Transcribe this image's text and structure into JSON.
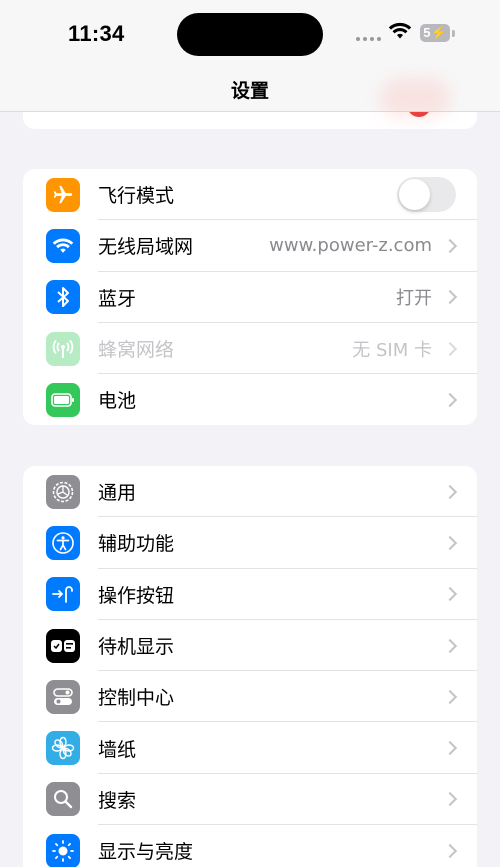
{
  "status_bar": {
    "time": "11:34",
    "battery_level": "5"
  },
  "nav": {
    "title": "设置"
  },
  "colors": {
    "airplane": "#ff9500",
    "wifi": "#007aff",
    "bluetooth": "#007aff",
    "cellular": "#34c759",
    "battery": "#34c759",
    "general": "#8e8e93",
    "accessibility": "#007aff",
    "action_button": "#007aff",
    "standby": "#000000",
    "control_center": "#8e8e93",
    "wallpaper": "#32ade6",
    "search": "#8e8e93",
    "display": "#007aff"
  },
  "group1": {
    "airplane": {
      "label": "飞行模式",
      "icon": "airplane-icon",
      "toggle_on": false
    },
    "wifi": {
      "label": "无线局域网",
      "value": "www.power-z.com",
      "icon": "wifi-icon"
    },
    "bluetooth": {
      "label": "蓝牙",
      "value": "打开",
      "icon": "bluetooth-icon"
    },
    "cellular": {
      "label": "蜂窝网络",
      "value": "无 SIM 卡",
      "icon": "antenna-icon"
    },
    "battery": {
      "label": "电池",
      "icon": "battery-icon"
    }
  },
  "group2": {
    "general": {
      "label": "通用",
      "icon": "gear-icon"
    },
    "accessibility": {
      "label": "辅助功能",
      "icon": "accessibility-icon"
    },
    "action_button": {
      "label": "操作按钮",
      "icon": "action-button-icon"
    },
    "standby": {
      "label": "待机显示",
      "icon": "standby-icon"
    },
    "control_center": {
      "label": "控制中心",
      "icon": "toggles-icon"
    },
    "wallpaper": {
      "label": "墙纸",
      "icon": "flower-icon"
    },
    "search": {
      "label": "搜索",
      "icon": "search-icon"
    },
    "display": {
      "label": "显示与亮度",
      "icon": "sun-icon"
    }
  }
}
